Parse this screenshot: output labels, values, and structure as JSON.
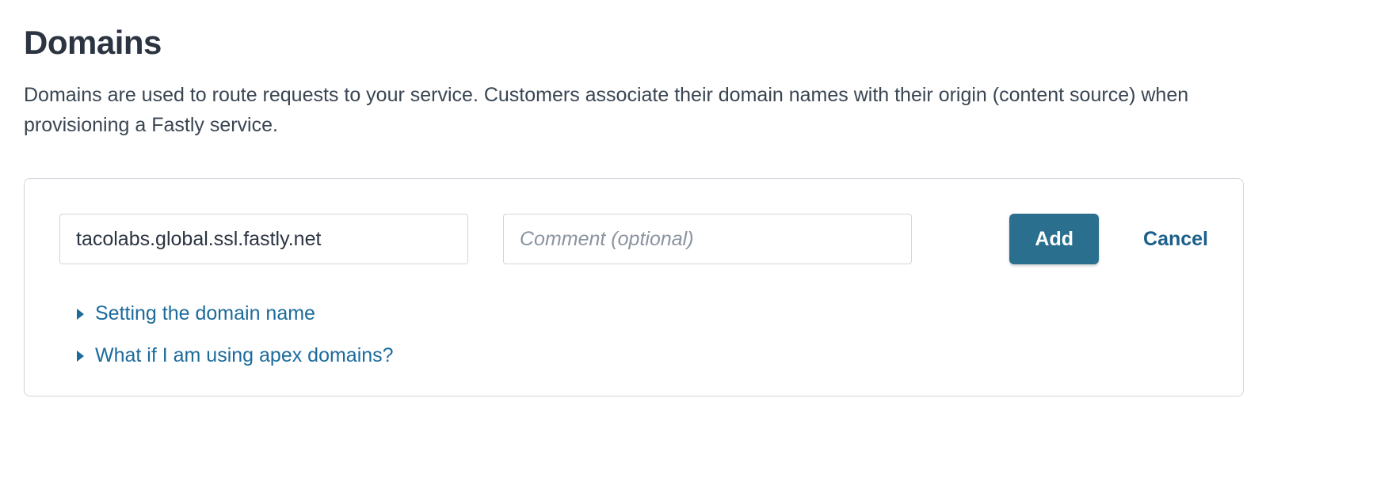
{
  "header": {
    "title": "Domains",
    "description": "Domains are used to route requests to your service. Customers associate their domain names with their origin (content source) when provisioning a Fastly service."
  },
  "form": {
    "domain_value": "tacolabs.global.ssl.fastly.net",
    "comment_placeholder": "Comment (optional)",
    "add_label": "Add",
    "cancel_label": "Cancel"
  },
  "help": {
    "links": [
      "Setting the domain name",
      "What if I am using apex domains?"
    ]
  }
}
